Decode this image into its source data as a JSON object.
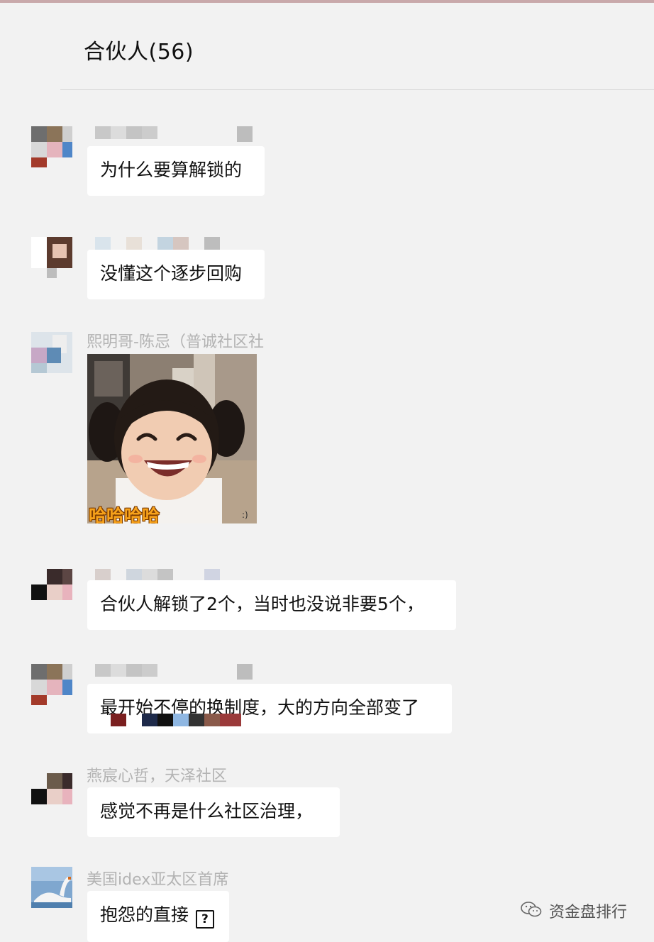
{
  "header": {
    "title": "合伙人(56)"
  },
  "messages": [
    {
      "text": "为什么要算解锁的"
    },
    {
      "text": "没懂这个逐步回购"
    },
    {
      "sender": "熙明哥-陈忌（普诚社区社",
      "sticker_caption": "哈哈哈哈"
    },
    {
      "text": "合伙人解锁了2个，当时也没说非要5个，"
    },
    {
      "text": "最开始不停的换制度，大的方向全部变了"
    },
    {
      "sender": "燕宸心哲，天泽社区",
      "text": "感觉不再是什么社区治理，"
    },
    {
      "sender": "美国idex亚太区首席",
      "text": "抱怨的直接"
    }
  ],
  "watermark": {
    "icon": "wechat-icon",
    "text": "资金盘排行"
  },
  "colors": {
    "background": "#f2f2f2",
    "bubble": "#ffffff",
    "sender_name": "#b3b3b3",
    "sticker_caption": "#f7a21b"
  }
}
